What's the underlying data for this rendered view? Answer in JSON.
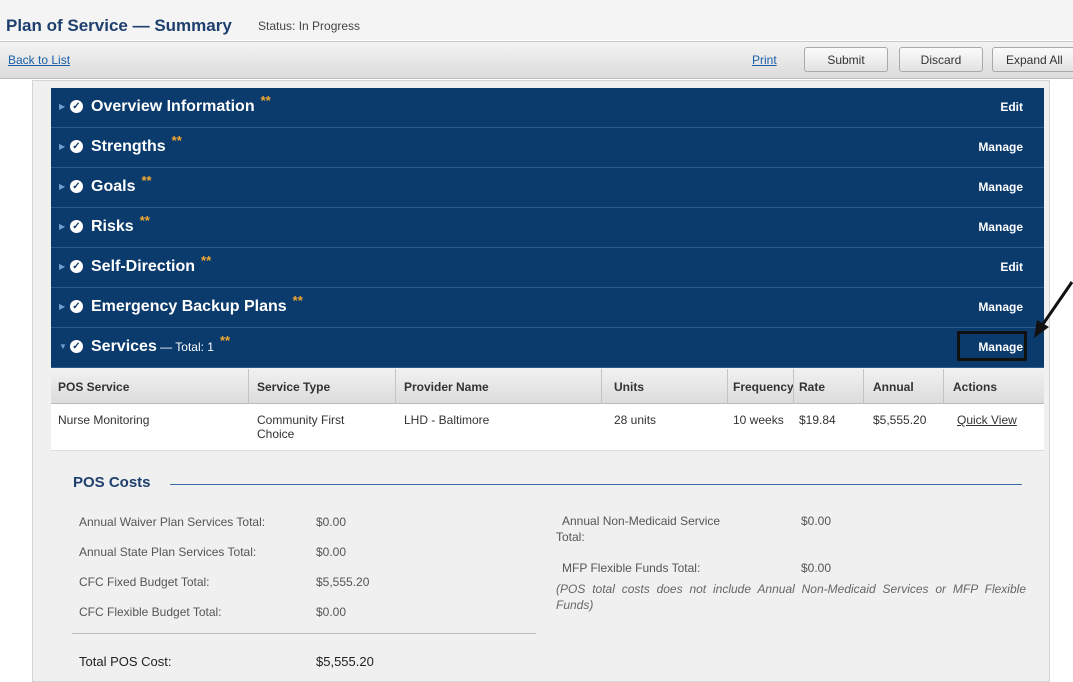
{
  "header": {
    "title": "Plan of Service — Summary",
    "status": "Status: In Progress"
  },
  "toolbar": {
    "back": "Back to List",
    "print": "Print",
    "submit": "Submit",
    "discard": "Discard",
    "expand": "Expand All"
  },
  "sections": [
    {
      "title": "Overview Information",
      "extra": "",
      "stars": "**",
      "action": "Edit"
    },
    {
      "title": "Strengths",
      "extra": "",
      "stars": "**",
      "action": "Manage"
    },
    {
      "title": "Goals",
      "extra": "",
      "stars": "**",
      "action": "Manage"
    },
    {
      "title": "Risks",
      "extra": "",
      "stars": "**",
      "action": "Manage"
    },
    {
      "title": "Self-Direction",
      "extra": "",
      "stars": "**",
      "action": "Edit"
    },
    {
      "title": "Emergency Backup Plans",
      "extra": "",
      "stars": "**",
      "action": "Manage"
    },
    {
      "title": "Services",
      "extra": " — Total: 1",
      "stars": "**",
      "action": "Manage"
    }
  ],
  "services_table": {
    "headers": [
      "POS Service",
      "Service Type",
      "Provider Name",
      "Units",
      "Frequency",
      "Rate",
      "Annual",
      "Actions"
    ],
    "rows": [
      {
        "service": "Nurse Monitoring",
        "type_line1": "Community First",
        "type_line2": "Choice",
        "provider": "LHD - Baltimore",
        "units": "28 units",
        "frequency": "10 weeks",
        "rate": "$19.84",
        "annual": "$5,555.20",
        "action": "Quick View"
      }
    ]
  },
  "pos_costs": {
    "title": "POS Costs",
    "left": [
      {
        "label": "Annual Waiver Plan Services Total:",
        "value": "$0.00"
      },
      {
        "label": "Annual State Plan Services Total:",
        "value": "$0.00"
      },
      {
        "label": "CFC Fixed Budget Total:",
        "value": "$5,555.20"
      },
      {
        "label": "CFC Flexible Budget Total:",
        "value": "$0.00"
      }
    ],
    "right": [
      {
        "label_line1": "Annual Non-Medicaid Service",
        "label_line2": "Total:",
        "value": "$0.00"
      },
      {
        "label_line1": "MFP Flexible Funds Total:",
        "label_line2": "",
        "value": "$0.00"
      }
    ],
    "note": "(POS total costs does not include Annual Non-Medicaid Services or MFP Flexible Funds)",
    "total_label": "Total POS Cost:",
    "total_value": "$5,555.20"
  },
  "colors": {
    "section_bg": "#0b3a6c",
    "link": "#1a5fa8",
    "star": "#f0a830"
  }
}
